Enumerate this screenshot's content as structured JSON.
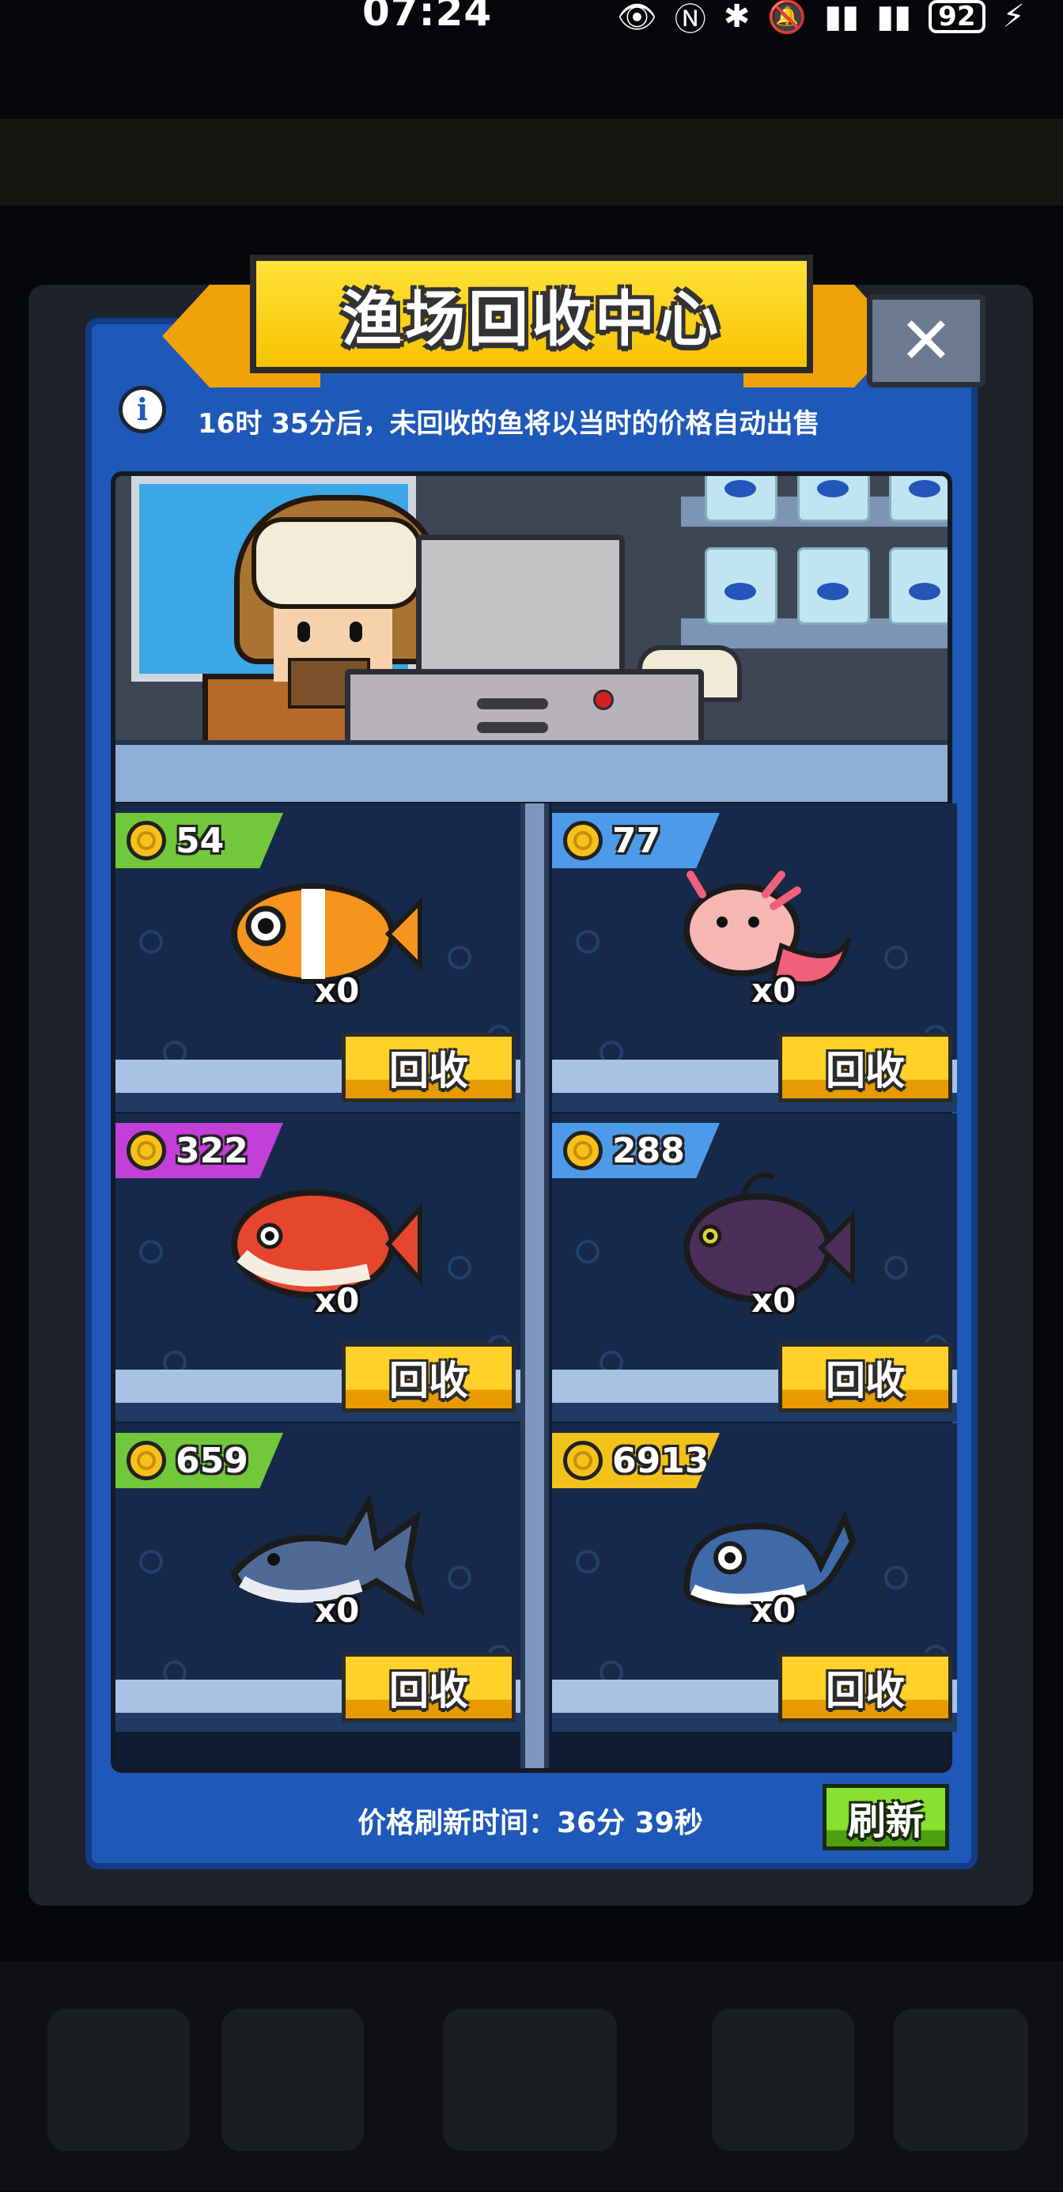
{
  "status_bar": {
    "time": "07:24",
    "battery": "92"
  },
  "dialog": {
    "title": "渔场回收中心",
    "close_label": "✕",
    "info_label": "i",
    "notice": "16时 35分后，未回收的鱼将以当时的价格自动出售",
    "footer": "价格刷新时间：36分 39秒",
    "refresh_label": "刷新"
  },
  "fish": [
    {
      "icon": "clownfish-icon",
      "price": "54",
      "count": "x0",
      "button": "回收",
      "tag_color": "#72c83a",
      "body_color": "#f7941d"
    },
    {
      "icon": "axolotl-icon",
      "price": "77",
      "count": "x0",
      "button": "回收",
      "tag_color": "#4d9be8",
      "body_color": "#f6b7b4"
    },
    {
      "icon": "red-snapper-icon",
      "price": "322",
      "count": "x0",
      "button": "回收",
      "tag_color": "#c23fd8",
      "body_color": "#e6452e"
    },
    {
      "icon": "anglerfish-icon",
      "price": "288",
      "count": "x0",
      "button": "回收",
      "tag_color": "#4d9be8",
      "body_color": "#4c2e5a"
    },
    {
      "icon": "shark-icon",
      "price": "659",
      "count": "x0",
      "button": "回收",
      "tag_color": "#72c83a",
      "body_color": "#4f6a97"
    },
    {
      "icon": "whale-icon",
      "price": "6913",
      "count": "x0",
      "button": "回收",
      "tag_color": "#f2c21b",
      "body_color": "#3f6aa8"
    }
  ]
}
